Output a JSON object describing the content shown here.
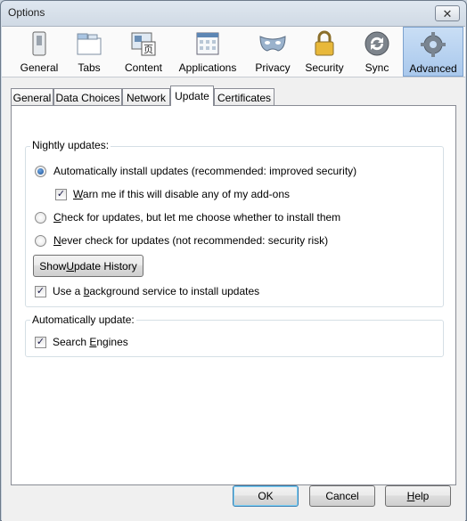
{
  "window": {
    "title": "Options",
    "close_glyph": "✕"
  },
  "toolbar": {
    "panes": [
      {
        "label": "General",
        "icon": "general-icon"
      },
      {
        "label": "Tabs",
        "icon": "tabs-icon"
      },
      {
        "label": "Content",
        "icon": "content-icon"
      },
      {
        "label": "Applications",
        "icon": "applications-icon"
      },
      {
        "label": "Privacy",
        "icon": "privacy-mask-icon"
      },
      {
        "label": "Security",
        "icon": "padlock-icon"
      },
      {
        "label": "Sync",
        "icon": "sync-icon"
      },
      {
        "label": "Advanced",
        "icon": "gear-icon",
        "selected": true
      }
    ]
  },
  "tabs": [
    "General",
    "Data Choices",
    "Network",
    "Update",
    "Certificates"
  ],
  "selected_tab": "Update",
  "nightly": {
    "legend": "Nightly updates:",
    "auto_install": "Automatically install updates (recommended: improved security)",
    "warn_pre": "",
    "warn_accel": "W",
    "warn_rest": "arn me if this will disable any of my add-ons",
    "check_accel": "C",
    "check_rest": "heck for updates, but let me choose whether to install them",
    "never_accel": "N",
    "never_rest": "ever check for updates (not recommended: security risk)",
    "history_pre": "Show ",
    "history_accel": "U",
    "history_rest": "pdate History",
    "background_pre": "Use a ",
    "background_accel": "b",
    "background_rest": "ackground service to install updates"
  },
  "auto_update": {
    "legend": "Automatically update:",
    "search_pre": "Search ",
    "search_accel": "E",
    "search_rest": "ngines"
  },
  "buttons": {
    "ok": "OK",
    "cancel": "Cancel",
    "help_accel": "H",
    "help_rest": "elp"
  },
  "colors": {
    "accent": "#3c7fb1",
    "selected_pane": "#a9c8ec"
  }
}
